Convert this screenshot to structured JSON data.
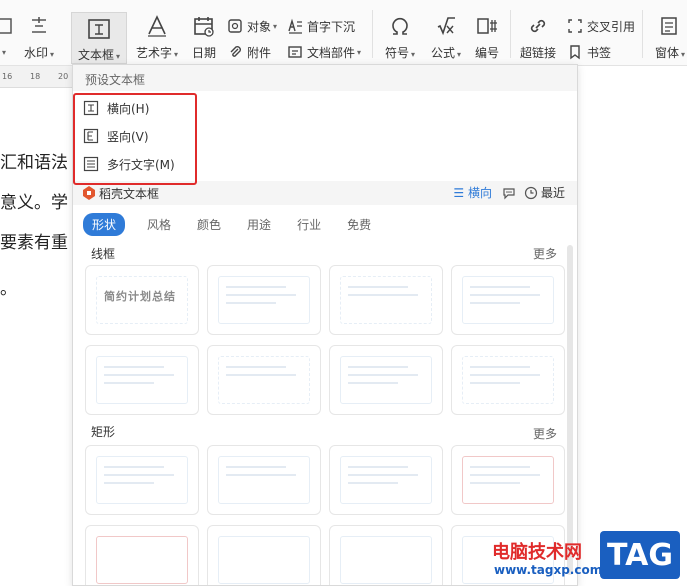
{
  "ribbon": {
    "watermark_label": "水印",
    "textbox_label": "文本框",
    "wordart_label": "艺术字",
    "date_label": "日期",
    "object_label": "对象",
    "attachment_label": "附件",
    "dropcap_label": "首字下沉",
    "docparts_label": "文档部件",
    "symbol_label": "符号",
    "formula_label": "公式",
    "numbering_label": "编号",
    "hyperlink_label": "超链接",
    "crossref_label": "交叉引用",
    "bookmark_label": "书签",
    "window_label": "窗体"
  },
  "ruler": {
    "ticks": [
      "16",
      "18",
      "20"
    ]
  },
  "document": {
    "lines": [
      "汇和语法",
      "意义。学",
      "要素有重",
      "。"
    ]
  },
  "dropdown": {
    "preset_header": "预设文本框",
    "items": [
      {
        "label": "横向(H)"
      },
      {
        "label": "竖向(V)"
      },
      {
        "label": "多行文字(M)"
      }
    ],
    "shell_title": "稻壳文本框",
    "orientation": "横向",
    "recent": "最近",
    "tabs": [
      "形状",
      "风格",
      "颜色",
      "用途",
      "行业",
      "免费"
    ],
    "active_tab": "形状",
    "sections": [
      {
        "title": "线框",
        "more": "更多"
      },
      {
        "title": "矩形",
        "more": "更多"
      }
    ],
    "card_sample_title": "简约计划总结"
  },
  "watermark": {
    "site_name": "电脑技术网",
    "url": "www.tagxp.com",
    "badge": "TAG"
  },
  "colors": {
    "accent": "#2f7bd8",
    "highlight_box": "#e02b2b"
  }
}
